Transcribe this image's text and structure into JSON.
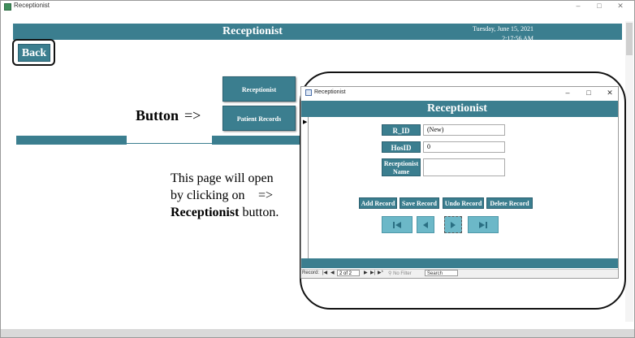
{
  "window": {
    "title": "Receptionist",
    "controls": {
      "minimize": "–",
      "maximize": "□",
      "close": "✕"
    }
  },
  "header": {
    "title": "Receptionist",
    "date": "Tuesday, June 15, 2021",
    "time": "2:17:56 AM"
  },
  "back_button": "Back",
  "nav_buttons": {
    "receptionist": "Receptionist",
    "patient_records": "Patient Records"
  },
  "annotation": {
    "button_label": "Button",
    "button_arrow": "=>",
    "line1": "This page will open",
    "line2": "by clicking on",
    "line2_arrow": "=>",
    "line3_bold": "Receptionist",
    "line3_rest": " button."
  },
  "popup": {
    "title": "Receptionist",
    "header_title": "Receptionist",
    "controls": {
      "minimize": "–",
      "maximize": "□",
      "close": "✕"
    },
    "fields": {
      "rid_label": "R_ID",
      "rid_value": "(New)",
      "hosid_label": "HosID",
      "hosid_value": "0",
      "name_label": "Receptionist Name",
      "name_value": ""
    },
    "record_buttons": {
      "add": "Add Record",
      "save": "Save Record",
      "undo": "Undo Record",
      "delete": "Delete Record"
    },
    "nav_glyphs": {
      "first": "▶|",
      "prev": "◀",
      "next": "▶",
      "last": "▶|"
    },
    "status_bar": {
      "record_label": "Record:",
      "first": "|◀",
      "prev": "◀",
      "position": "2 of 2",
      "next": "▶",
      "last": "▶|",
      "new": "▶*",
      "filter": "No Filter",
      "search": "Search"
    }
  },
  "colors": {
    "accent": "#3b7e8f",
    "nav_arrow": "#6cb8c8"
  }
}
